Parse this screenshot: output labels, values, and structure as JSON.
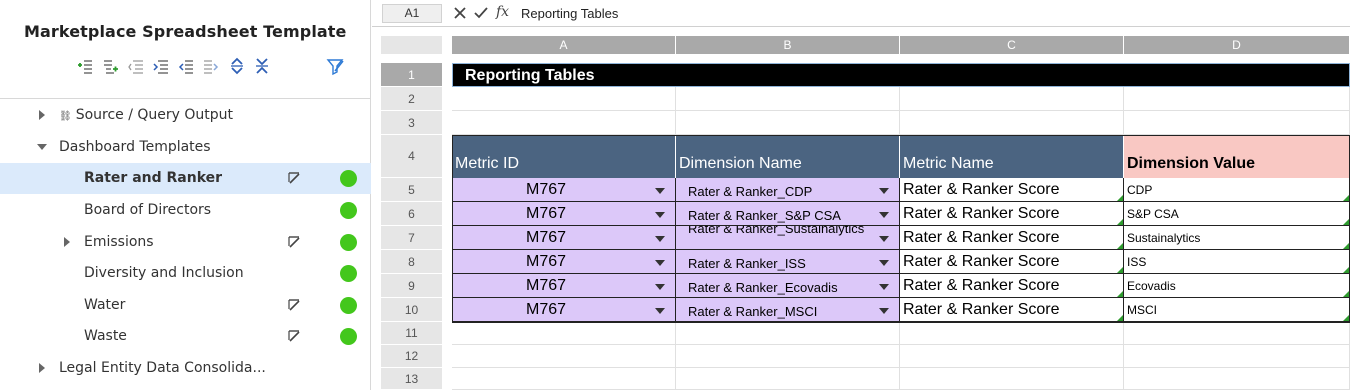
{
  "panel": {
    "title": "Marketplace Spreadsheet Template",
    "toolbar_icons": [
      "add-row-icon",
      "add-child-icon",
      "outdent-icon",
      "indent-icon",
      "move-left-icon",
      "move-right-icon",
      "expand-icon",
      "collapse-icon"
    ],
    "filter_icon": "filter-edit-icon",
    "tree": [
      {
        "label": "Source / Query Output",
        "indent": 0,
        "caret": "right",
        "prefix": "⛓",
        "selected": false,
        "edit": false,
        "status": null
      },
      {
        "label": "Dashboard Templates",
        "indent": 0,
        "caret": "down",
        "selected": false,
        "edit": false,
        "status": null
      },
      {
        "label": "Rater and Ranker",
        "indent": 1,
        "caret": null,
        "selected": true,
        "edit": true,
        "status": "green"
      },
      {
        "label": "Board of Directors",
        "indent": 1,
        "caret": null,
        "selected": false,
        "edit": false,
        "status": "green"
      },
      {
        "label": "Emissions",
        "indent": 1,
        "caret": "right",
        "selected": false,
        "edit": true,
        "status": "green"
      },
      {
        "label": "Diversity and Inclusion",
        "indent": 1,
        "caret": null,
        "selected": false,
        "edit": false,
        "status": "green"
      },
      {
        "label": "Water",
        "indent": 1,
        "caret": null,
        "selected": false,
        "edit": true,
        "status": "green"
      },
      {
        "label": "Waste",
        "indent": 1,
        "caret": null,
        "selected": false,
        "edit": true,
        "status": "green"
      },
      {
        "label": "Legal Entity Data Consolida...",
        "indent": 0,
        "caret": "right",
        "selected": false,
        "edit": false,
        "status": null
      }
    ],
    "status_color": "#43c71c"
  },
  "formula_bar": {
    "cell_ref": "A1",
    "formula": "Reporting Tables",
    "fx_label": "fx"
  },
  "grid": {
    "columns": [
      "A",
      "B",
      "C",
      "D"
    ],
    "rows": [
      "1",
      "2",
      "3",
      "4",
      "5",
      "6",
      "7",
      "8",
      "9",
      "10",
      "11",
      "12",
      "13"
    ],
    "title": "Reporting Tables",
    "headers": [
      "Metric ID",
      "Dimension Name",
      "Metric Name",
      "Dimension Value"
    ],
    "data": [
      {
        "metric_id": "M767",
        "dimension_name": "Rater & Ranker_CDP",
        "metric_name": "Rater & Ranker Score",
        "dimension_value": "CDP"
      },
      {
        "metric_id": "M767",
        "dimension_name": "Rater & Ranker_S&P CSA",
        "metric_name": "Rater & Ranker Score",
        "dimension_value": "S&P CSA"
      },
      {
        "metric_id": "M767",
        "dimension_name": "Rater & Ranker_Sustainalytics",
        "metric_name": "Rater & Ranker Score",
        "dimension_value": "Sustainalytics"
      },
      {
        "metric_id": "M767",
        "dimension_name": "Rater & Ranker_ISS",
        "metric_name": "Rater & Ranker Score",
        "dimension_value": "ISS"
      },
      {
        "metric_id": "M767",
        "dimension_name": "Rater & Ranker_Ecovadis",
        "metric_name": "Rater & Ranker Score",
        "dimension_value": "Ecovadis"
      },
      {
        "metric_id": "M767",
        "dimension_name": "Rater & Ranker_MSCI",
        "metric_name": "Rater & Ranker Score",
        "dimension_value": "MSCI"
      }
    ],
    "colors": {
      "header_bg": "#4b6481",
      "header_highlight_bg": "#f9c8c3",
      "input_bg": "#dcc8f9",
      "title_bg": "#000000"
    }
  }
}
